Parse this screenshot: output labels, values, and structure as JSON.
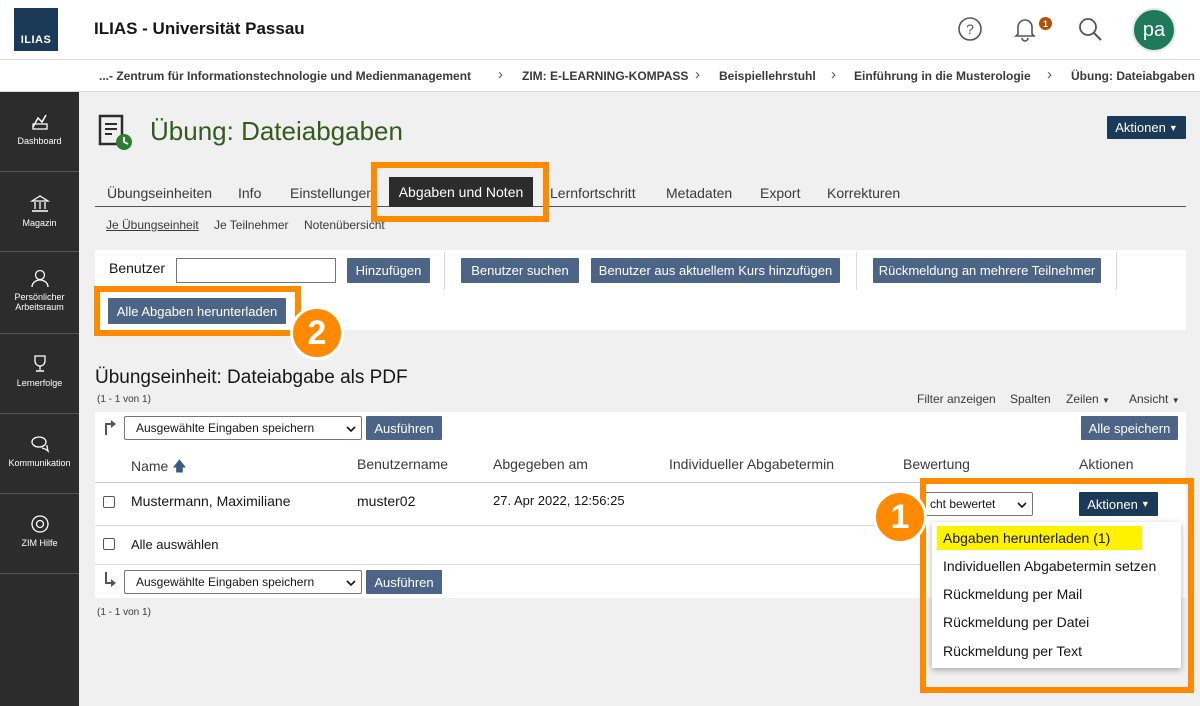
{
  "header": {
    "logo_text": "ILIAS",
    "title": "ILIAS - Universität Passau",
    "notification_count": "1",
    "avatar_initials": "pa"
  },
  "breadcrumb": [
    "...- Zentrum für Informationstechnologie und Medienmanagement",
    "ZIM: E-LEARNING-KOMPASS",
    "Beispiellehrstuhl",
    "Einführung in die Musterologie",
    "Übung: Dateiabgaben"
  ],
  "sidebar": [
    {
      "label": "Dashboard",
      "icon": "dashboard-icon"
    },
    {
      "label": "Magazin",
      "icon": "bank-icon"
    },
    {
      "label": "Persönlicher Arbeitsraum",
      "icon": "user-icon"
    },
    {
      "label": "Lernerfolge",
      "icon": "trophy-icon"
    },
    {
      "label": "Kommunikation",
      "icon": "chat-icon"
    },
    {
      "label": "ZIM Hilfe",
      "icon": "lifebuoy-icon"
    }
  ],
  "page": {
    "title": "Übung: Dateiabgaben",
    "actions_label": "Aktionen"
  },
  "tabs": [
    "Übungseinheiten",
    "Info",
    "Einstellungen",
    "Abgaben und Noten",
    "Lernfortschritt",
    "Metadaten",
    "Export",
    "Korrekturen"
  ],
  "subtabs": [
    "Je Übungseinheit",
    "Je Teilnehmer",
    "Notenübersicht"
  ],
  "toolbar": {
    "user_label": "Benutzer",
    "add": "Hinzufügen",
    "search_users": "Benutzer suchen",
    "add_from_course": "Benutzer aus aktuellem Kurs hinzufügen",
    "feedback_multiple": "Rückmeldung an mehrere Teilnehmer",
    "download_all": "Alle Abgaben herunterladen"
  },
  "section": {
    "title": "Übungseinheit: Dateiabgabe als PDF",
    "count_top": "(1 - 1 von 1)",
    "count_bottom": "(1 - 1 von 1)",
    "filter": "Filter anzeigen",
    "columns": "Spalten",
    "rows": "Zeilen",
    "view": "Ansicht",
    "select_action": "Ausgewählte Eingaben speichern",
    "execute": "Ausführen",
    "save_all": "Alle speichern"
  },
  "table": {
    "headers": [
      "Name",
      "Benutzername",
      "Abgegeben am",
      "Individueller Abgabetermin",
      "Bewertung",
      "Aktionen"
    ],
    "rows": [
      {
        "name": "Mustermann, Maximiliane",
        "username": "muster02",
        "submitted": "27. Apr 2022, 12:56:25",
        "grade": "nicht bewertet",
        "grade_visible": "cht bewertet",
        "actions": "Aktionen"
      }
    ],
    "select_all": "Alle auswählen"
  },
  "dropdown": [
    "Abgaben herunterladen (1)",
    "Individuellen Abgabetermin setzen",
    "Rückmeldung per Mail",
    "Rückmeldung per Datei",
    "Rückmeldung per Text"
  ],
  "annotations": [
    "1",
    "2"
  ],
  "colors": {
    "accent": "#ff8a00",
    "button": "#4c6586",
    "button_dark": "#1b3a57",
    "title_green": "#335b1d",
    "highlight": "#fff200"
  }
}
